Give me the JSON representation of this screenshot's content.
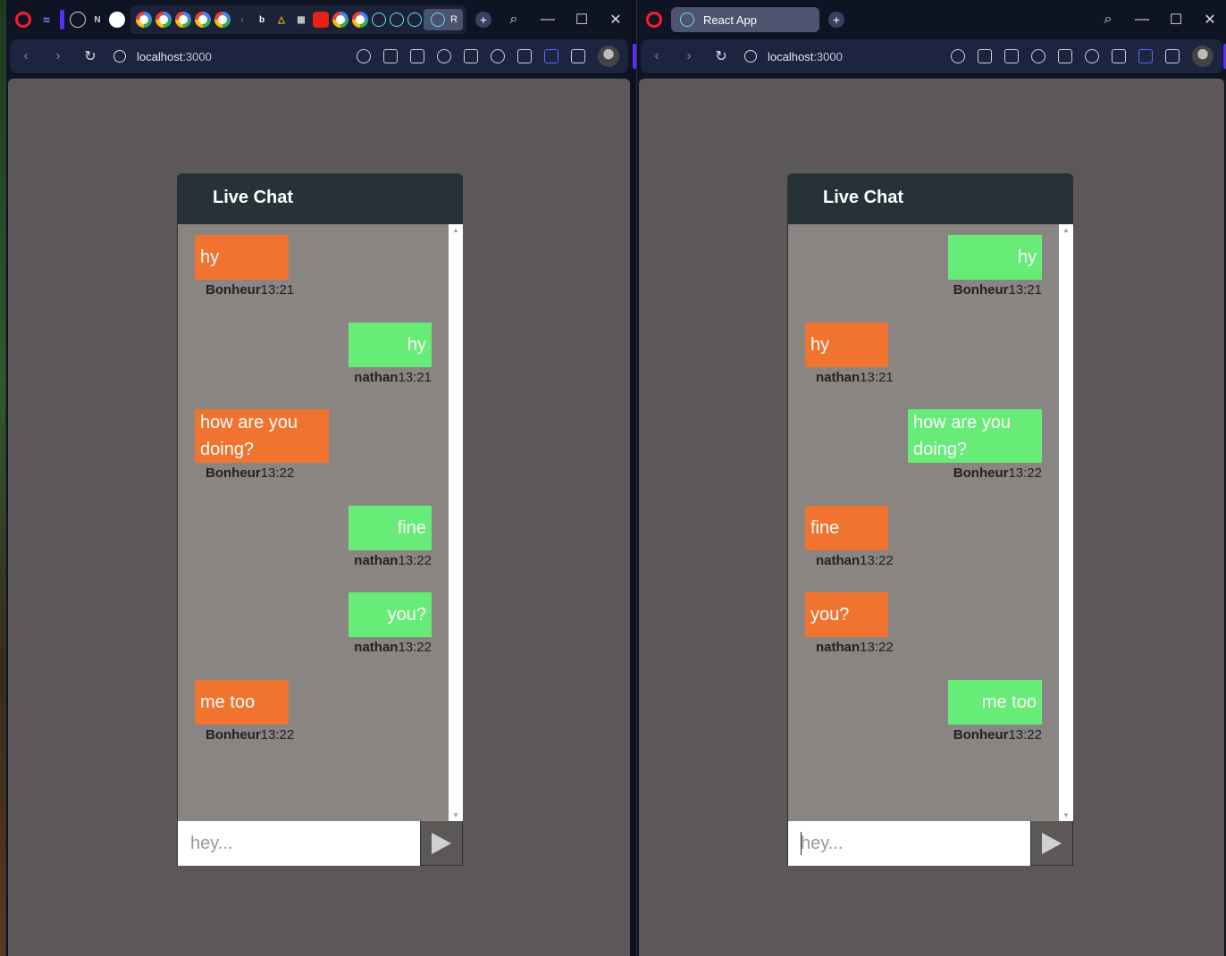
{
  "browser": {
    "left_tabs_group_label": "R",
    "right_tab_title": "React App",
    "url_host": "localhost",
    "url_port": ":3000",
    "new_tab_glyph": "+",
    "search_glyph": "⌕",
    "minimize_glyph": "—",
    "maximize_glyph": "☐",
    "close_glyph": "✕",
    "back_glyph": "‹",
    "forward_glyph": "›",
    "reload_glyph": "↻"
  },
  "chat": {
    "title": "Live Chat",
    "placeholder": "hey...",
    "colors": {
      "header": "#263238",
      "body": "#888583",
      "other_bubble": "#f07430",
      "own_bubble": "#67ec78",
      "page_bg": "#5d5858"
    }
  },
  "left_chat": {
    "messages": [
      {
        "text": "hy",
        "author": "Bonheur",
        "time": "13:21",
        "side": "left"
      },
      {
        "text": "hy",
        "author": "nathan",
        "time": "13:21",
        "side": "right"
      },
      {
        "text": "how are you doing?",
        "author": "Bonheur",
        "time": "13:22",
        "side": "left"
      },
      {
        "text": "fine",
        "author": "nathan",
        "time": "13:22",
        "side": "right"
      },
      {
        "text": "you?",
        "author": "nathan",
        "time": "13:22",
        "side": "right"
      },
      {
        "text": "me too",
        "author": "Bonheur",
        "time": "13:22",
        "side": "left"
      }
    ]
  },
  "right_chat": {
    "messages": [
      {
        "text": "hy",
        "author": "Bonheur",
        "time": "13:21",
        "side": "right"
      },
      {
        "text": "hy",
        "author": "nathan",
        "time": "13:21",
        "side": "left"
      },
      {
        "text": "how are you doing?",
        "author": "Bonheur",
        "time": "13:22",
        "side": "right"
      },
      {
        "text": "fine",
        "author": "nathan",
        "time": "13:22",
        "side": "left"
      },
      {
        "text": "you?",
        "author": "nathan",
        "time": "13:22",
        "side": "left"
      },
      {
        "text": "me too",
        "author": "Bonheur",
        "time": "13:22",
        "side": "right"
      }
    ]
  }
}
